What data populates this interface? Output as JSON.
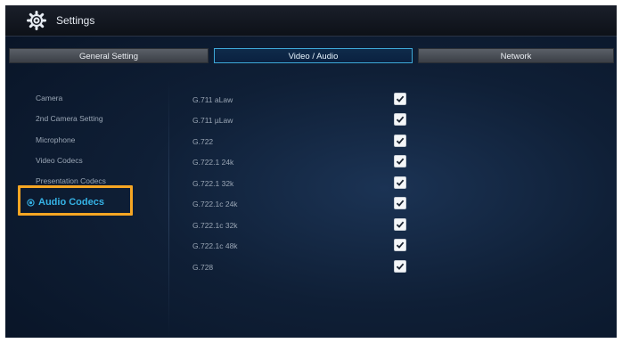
{
  "app": {
    "title": "Settings",
    "icon": "gear-icon"
  },
  "tabs": [
    {
      "label": "General Setting",
      "active": false
    },
    {
      "label": "Video / Audio",
      "active": true
    },
    {
      "label": "Network",
      "active": false
    }
  ],
  "sidebar": {
    "items": [
      {
        "label": "Camera"
      },
      {
        "label": "2nd Camera Setting"
      },
      {
        "label": "Microphone"
      },
      {
        "label": "Video Codecs"
      },
      {
        "label": "Presentation Codecs"
      },
      {
        "label": "Audio Codecs",
        "selected": true
      }
    ]
  },
  "codecs": [
    {
      "label": "G.711 aLaw",
      "checked": true
    },
    {
      "label": "G.711 µLaw",
      "checked": true
    },
    {
      "label": "G.722",
      "checked": true
    },
    {
      "label": "G.722.1 24k",
      "checked": true
    },
    {
      "label": "G.722.1 32k",
      "checked": true
    },
    {
      "label": "G.722.1c 24k",
      "checked": true
    },
    {
      "label": "G.722.1c 32k",
      "checked": true
    },
    {
      "label": "G.722.1c 48k",
      "checked": true
    },
    {
      "label": "G.728",
      "checked": true
    }
  ],
  "colors": {
    "accent": "#35b3e6",
    "highlight": "#f6a623",
    "background": "#0f1f36"
  }
}
